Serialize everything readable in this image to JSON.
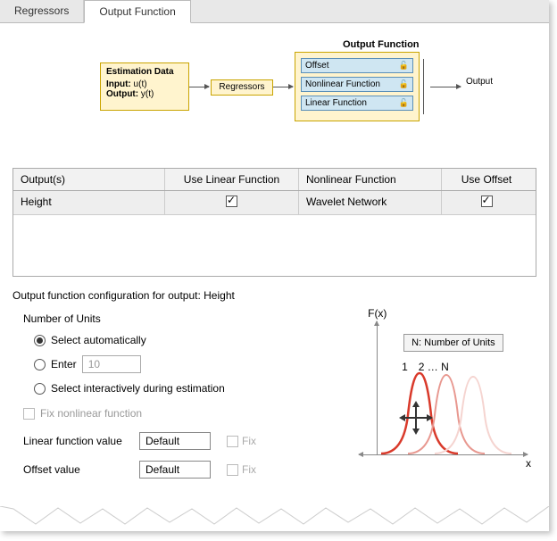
{
  "tabs": {
    "regressors": "Regressors",
    "output_function": "Output Function"
  },
  "diagram": {
    "est_title": "Estimation Data",
    "input_label": "Input:",
    "input_val": "u(t)",
    "output_label": "Output:",
    "output_val": "y(t)",
    "regressors": "Regressors",
    "ofn_title": "Output Function",
    "offset": "Offset",
    "nonlinear": "Nonlinear Function",
    "linear": "Linear Function",
    "output": "Output"
  },
  "grid": {
    "headers": {
      "outputs": "Output(s)",
      "use_linear": "Use Linear Function",
      "nonlinear": "Nonlinear Function",
      "use_offset": "Use Offset"
    },
    "rows": [
      {
        "output": "Height",
        "use_linear": true,
        "nonlinear": "Wavelet Network",
        "use_offset": true
      }
    ]
  },
  "config_label": "Output function configuration for output: Height",
  "units": {
    "group_title": "Number of Units",
    "auto": "Select automatically",
    "enter": "Enter",
    "enter_value": "10",
    "interactive": "Select interactively during estimation",
    "selected": "auto"
  },
  "fix_nonlinear": "Fix nonlinear function",
  "linear_value": {
    "label": "Linear function value",
    "value": "Default",
    "fix": "Fix"
  },
  "offset_value": {
    "label": "Offset value",
    "value": "Default",
    "fix": "Fix"
  },
  "plot": {
    "fx": "F(x)",
    "x": "x",
    "nbox": "N: Number of Units",
    "n1": "1",
    "n2": "2 … N"
  }
}
